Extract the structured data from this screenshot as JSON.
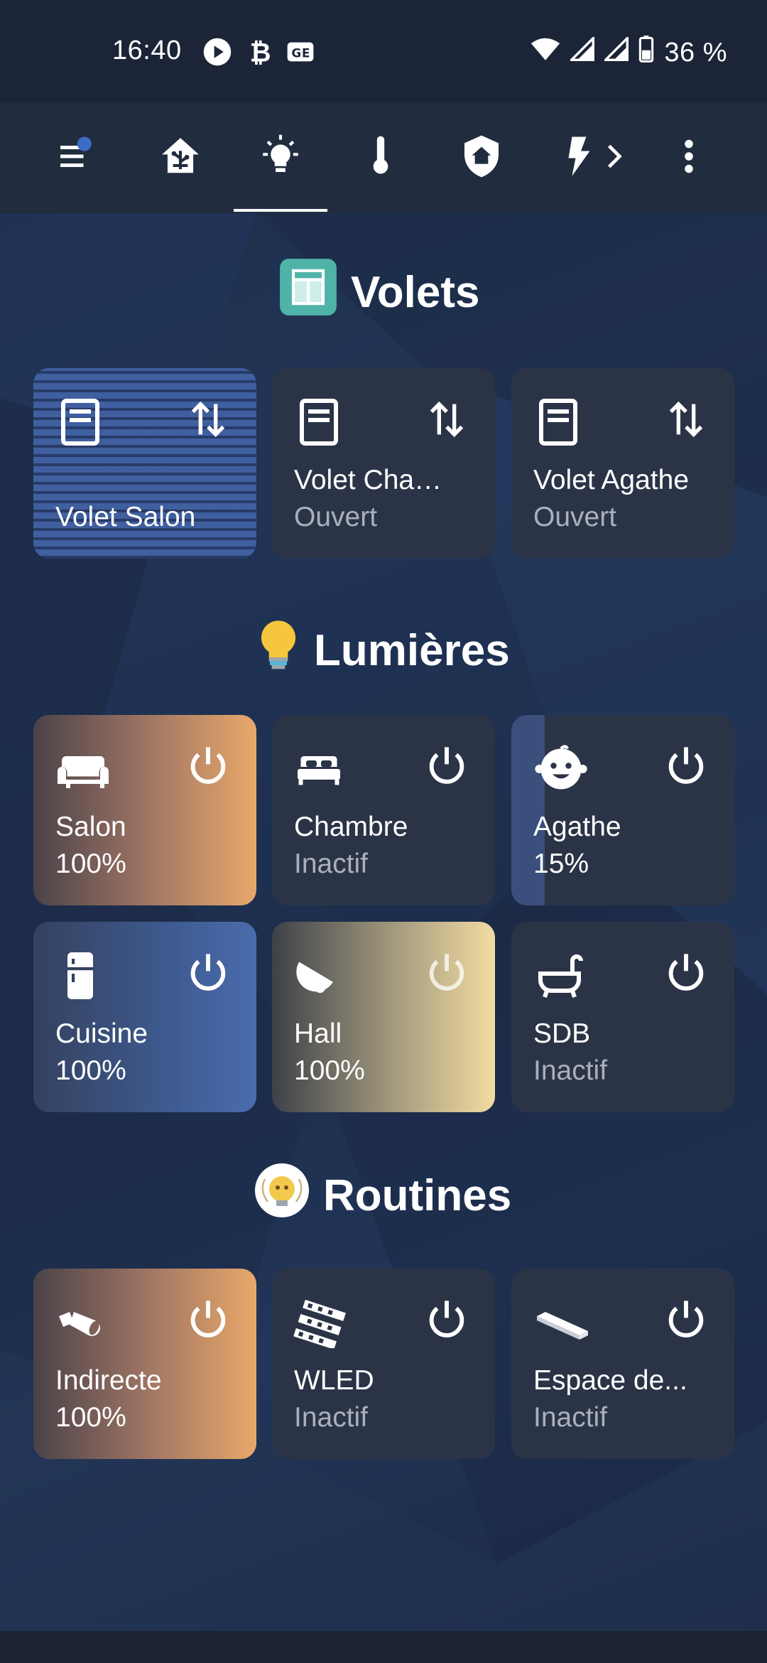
{
  "statusbar": {
    "time": "16:40",
    "battery": "36 %",
    "icons_left": [
      "play-icon",
      "bitcoin-icon",
      "ge-icon"
    ],
    "icons_right": [
      "wifi-icon",
      "signal-icon",
      "signal-icon",
      "battery-icon"
    ]
  },
  "toolbar": {
    "items": [
      "menu-icon",
      "home-network-icon",
      "lightbulb-icon",
      "thermometer-icon",
      "shield-home-icon",
      "flash-icon",
      "more-vert-icon"
    ],
    "active_index": 2,
    "notification_badge_color": "#3d6cc4"
  },
  "sections": {
    "volets": {
      "title": "Volets",
      "cards": [
        {
          "name": "Volet Salon",
          "state": ""
        },
        {
          "name": "Volet Chambre",
          "state": "Ouvert"
        },
        {
          "name": "Volet Agathe",
          "state": "Ouvert"
        }
      ]
    },
    "lumieres": {
      "title": "Lumières",
      "cards": [
        {
          "name": "Salon",
          "state": "100%"
        },
        {
          "name": "Chambre",
          "state": "Inactif"
        },
        {
          "name": "Agathe",
          "state": "15%"
        },
        {
          "name": "Cuisine",
          "state": "100%"
        },
        {
          "name": "Hall",
          "state": "100%"
        },
        {
          "name": "SDB",
          "state": "Inactif"
        }
      ]
    },
    "routines": {
      "title": "Routines",
      "cards": [
        {
          "name": "Indirecte",
          "state": "100%"
        },
        {
          "name": "WLED",
          "state": "Inactif"
        },
        {
          "name": "Espace de...",
          "state": "Inactif"
        }
      ]
    }
  },
  "colors": {
    "background": "#1e2c48",
    "card": "#2b3447",
    "warm_gradient_end": "#e9a86a",
    "cool_gradient_end": "#4a6cad",
    "hall_gradient_end": "#f3dca2",
    "inactive_text": "#a9b0bd"
  }
}
